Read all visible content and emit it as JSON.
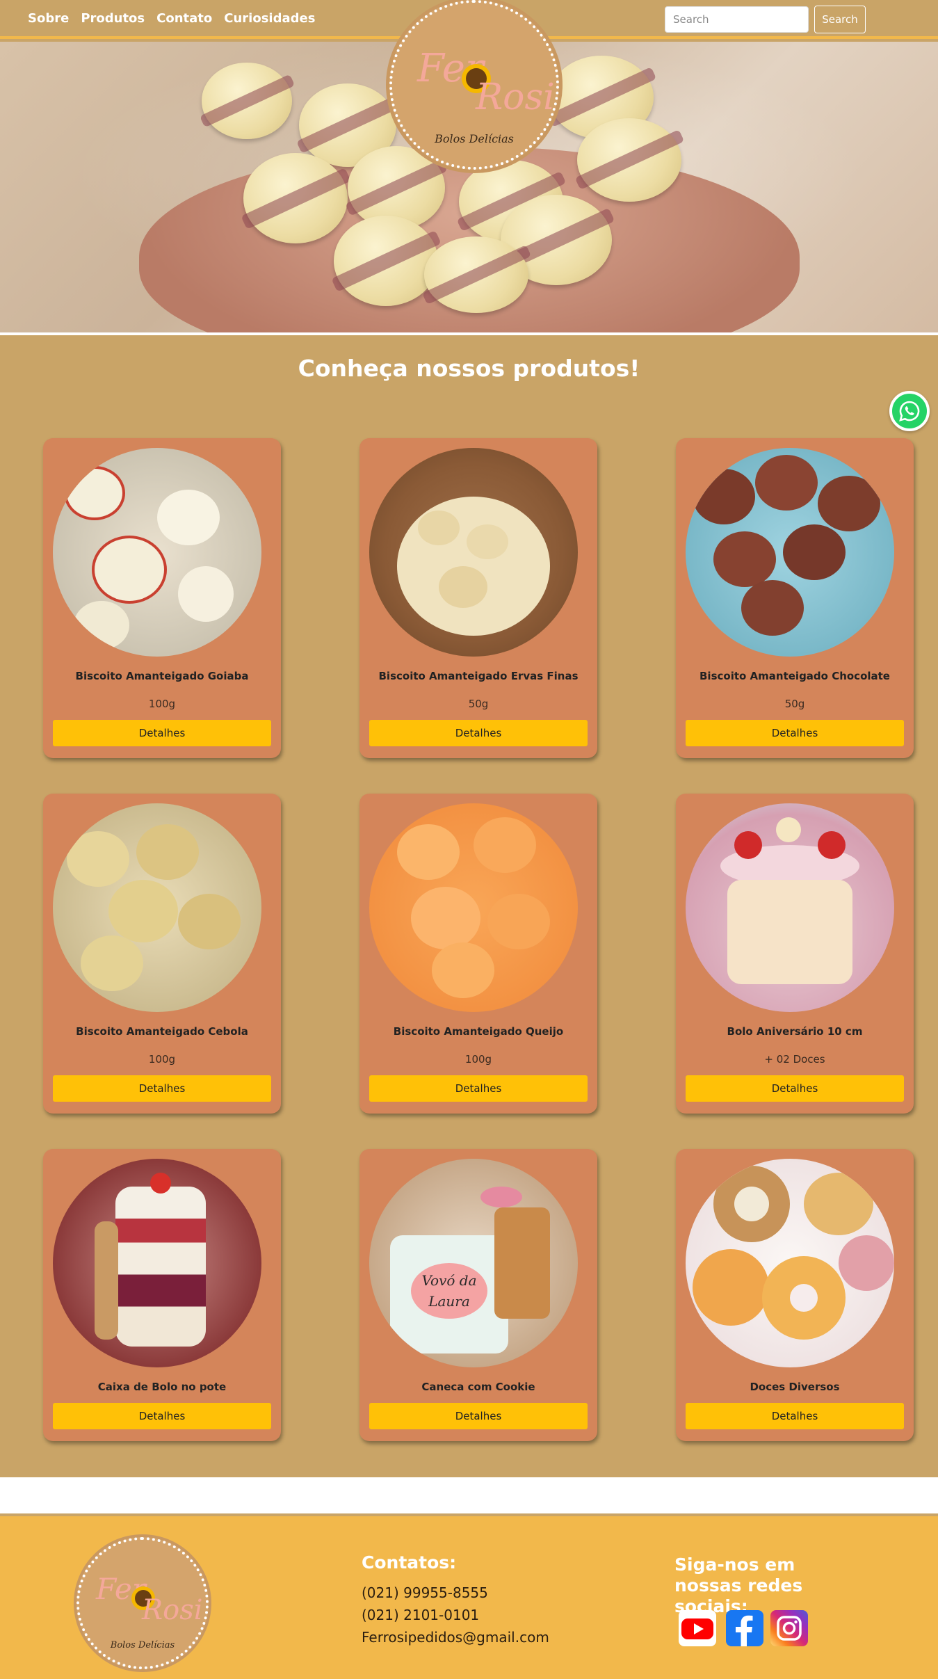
{
  "navbar": {
    "links": [
      "Sobre",
      "Produtos",
      "Contato",
      "Curiosidades"
    ],
    "search_placeholder": "Search",
    "search_button": "Search"
  },
  "logo": {
    "word1": "Fer",
    "word2": "Rosi",
    "tagline": "Bolos Delícias"
  },
  "section": {
    "title": "Conheça nossos produtos!"
  },
  "products": [
    {
      "name": "Biscoito Amanteigado Goiaba",
      "weight": "100g",
      "button": "Detalhes",
      "image": "goiaba-cookies"
    },
    {
      "name": "Biscoito Amanteigado Ervas Finas",
      "weight": "50g",
      "button": "Detalhes",
      "image": "ervas-cookies"
    },
    {
      "name": "Biscoito Amanteigado Chocolate",
      "weight": "50g",
      "button": "Detalhes",
      "image": "chocolate-cookies"
    },
    {
      "name": "Biscoito Amanteigado Cebola",
      "weight": "100g",
      "button": "Detalhes",
      "image": "cebola-cookies"
    },
    {
      "name": "Biscoito Amanteigado Queijo",
      "weight": "100g",
      "button": "Detalhes",
      "image": "queijo-cookies"
    },
    {
      "name": "Bolo Aniversário 10 cm",
      "weight": "+ 02 Doces",
      "button": "Detalhes",
      "image": "birthday-cake"
    },
    {
      "name": "Caixa de Bolo no pote",
      "weight": "",
      "button": "Detalhes",
      "image": "cake-jar"
    },
    {
      "name": "Caneca com Cookie",
      "weight": "",
      "button": "Detalhes",
      "image": "mug-cookie",
      "mug_text": "Vovó da Laura"
    },
    {
      "name": "Doces Diversos",
      "weight": "",
      "button": "Detalhes",
      "image": "donuts"
    }
  ],
  "footer": {
    "contacts_title": "Contatos:",
    "phone1": "(021) 99955-8555",
    "phone2": "(021) 2101-0101",
    "email": "Ferrosipedidos@gmail.com",
    "social_title": "Siga-nos em nossas redes sociais:",
    "social_icons": [
      "youtube-icon",
      "facebook-icon",
      "instagram-icon"
    ]
  },
  "colors": {
    "background": "#c9a467",
    "card": "#d4855a",
    "button": "#ffc107",
    "footer": "#f2b84b",
    "whatsapp": "#25d366"
  }
}
